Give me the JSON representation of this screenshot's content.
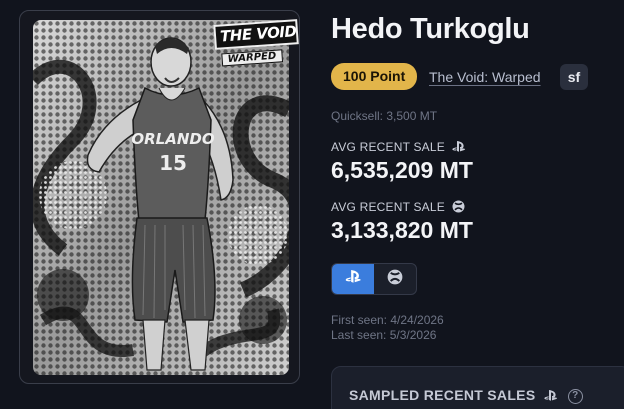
{
  "card": {
    "logo_main": "THE VOID",
    "logo_sub": "WARPED",
    "jersey_team": "ORLANDO",
    "jersey_number": "15"
  },
  "player": {
    "name": "Hedo Turkoglu",
    "points_badge": "100 Point",
    "set_link": "The Void: Warped",
    "position_badge": "sf",
    "quicksell": "Quicksell: 3,500 MT"
  },
  "stats": {
    "ps_label": "AVG RECENT SALE",
    "ps_value": "6,535,209 MT",
    "xbox_label": "AVG RECENT SALE",
    "xbox_value": "3,133,820 MT"
  },
  "platform_toggle": {
    "options": [
      "playstation",
      "xbox"
    ],
    "selected": "playstation",
    "active_color": "#3b7ddd"
  },
  "dates": {
    "first_seen": "First seen: 4/24/2026",
    "last_seen": "Last seen: 5/3/2026"
  },
  "sales_panel": {
    "title": "SAMPLED RECENT SALES",
    "help": "?"
  },
  "colors": {
    "background": "#11141d",
    "gold": "#e2b54a",
    "accent_blue": "#3b7ddd"
  }
}
